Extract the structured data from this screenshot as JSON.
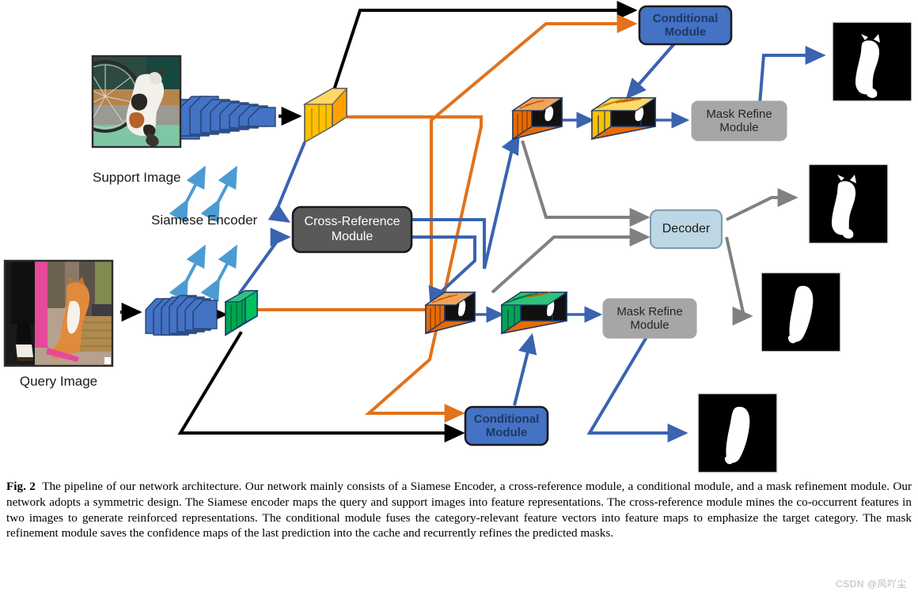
{
  "figure": {
    "images": [
      {
        "name": "support-image",
        "caption": "Support Image"
      },
      {
        "name": "query-image",
        "caption": "Query Image"
      }
    ],
    "labels": {
      "siamese_encoder": "Siamese Encoder"
    },
    "modules": [
      {
        "id": "conditional-module-top",
        "label": "Conditional Module",
        "line1": "Conditional",
        "line2": "Module",
        "fill": "#4472C4",
        "text": "#1F3864",
        "border": "#1a1a1a"
      },
      {
        "id": "cross-reference-module",
        "label": "Cross-Reference Module",
        "line1": "Cross-Reference",
        "line2": "Module",
        "fill": "#595959",
        "text": "#ffffff",
        "border": "#1a1a1a"
      },
      {
        "id": "mask-refine-module-top",
        "label": "Mask Refine Module",
        "line1": "Mask Refine",
        "line2": "Module",
        "fill": "#A6A6A6",
        "text": "#262626",
        "border": "#A6A6A6"
      },
      {
        "id": "decoder-module",
        "label": "Decoder",
        "line1": "Decoder",
        "line2": "",
        "fill": "#BDD7E4",
        "text": "#1a1a1a",
        "border": "#7F9DB0"
      },
      {
        "id": "mask-refine-module-bottom",
        "label": "Mask Refine Module",
        "line1": "Mask Refine",
        "line2": "Module",
        "fill": "#A6A6A6",
        "text": "#262626",
        "border": "#A6A6A6"
      },
      {
        "id": "conditional-module-bottom",
        "label": "Conditional Module",
        "line1": "Conditional",
        "line2": "Module",
        "fill": "#4472C4",
        "text": "#1F3864",
        "border": "#1a1a1a"
      }
    ],
    "output_masks": [
      {
        "name": "output-mask-support-refined",
        "shape": "sitting-cat"
      },
      {
        "name": "output-mask-support-decoder",
        "shape": "sitting-cat"
      },
      {
        "name": "output-mask-query-decoder",
        "shape": "standing-cat"
      },
      {
        "name": "output-mask-query-refined",
        "shape": "standing-cat"
      }
    ],
    "colors": {
      "arrow_black": "#000000",
      "arrow_blue": "#3A63B0",
      "arrow_orange": "#E2721B",
      "arrow_gray": "#808080",
      "arrow_lightblue": "#4B9CD3",
      "encoder_blue": "#4472C4",
      "feature_yellow": "#FFC000",
      "feature_green": "#00A650",
      "feature_orange": "#E36C09"
    }
  },
  "caption": {
    "label": "Fig. 2",
    "text": "The pipeline of our network architecture. Our network mainly consists of a Siamese Encoder, a cross-reference module, a conditional module, and a mask refinement module. Our network adopts a symmetric design. The Siamese encoder maps the query and support images into feature representations. The cross-reference module mines the co-occurrent features in two images to generate reinforced representations. The conditional module fuses the category-relevant feature vectors into feature maps to emphasize the target category. The mask refinement module saves the confidence maps of the last prediction into the cache and recurrently refines the predicted masks."
  },
  "watermark": {
    "text": "CSDN @风吖尘"
  }
}
